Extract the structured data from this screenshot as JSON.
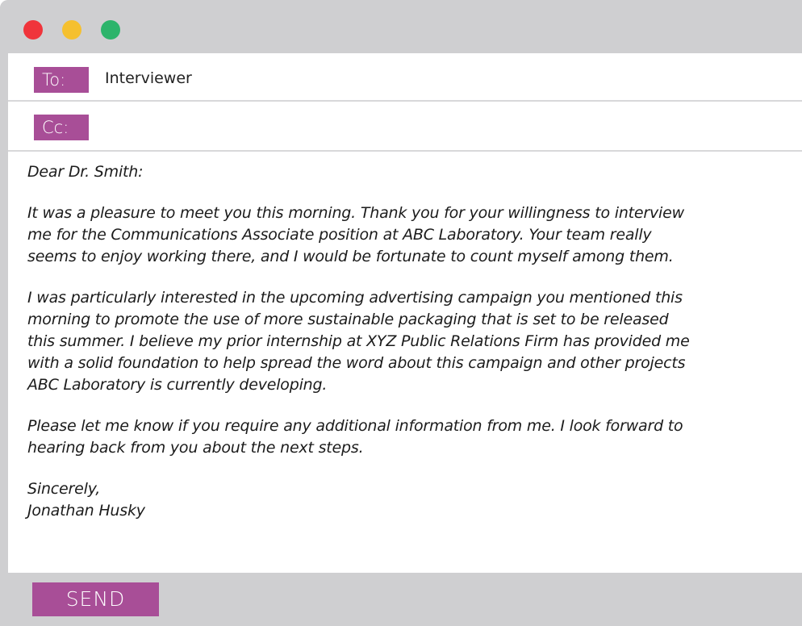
{
  "window": {
    "controls": [
      "close",
      "minimize",
      "maximize"
    ],
    "colors": {
      "close": "#f0343b",
      "minimize": "#f5c02f",
      "maximize": "#2db46b",
      "accent": "#a84e97"
    }
  },
  "header": {
    "to_label": "To:",
    "to_value": "Interviewer",
    "cc_label": "Cc:",
    "cc_value": ""
  },
  "body": {
    "greeting": "Dear Dr. Smith:",
    "paragraph1": [
      "It was a pleasure to meet you this morning. Thank you for your willingness to interview",
      "me for the Communications Associate position at ABC Laboratory. Your team really",
      "seems to enjoy working there, and I would be fortunate to count myself among them."
    ],
    "paragraph2": [
      "I was particularly interested in the upcoming advertising campaign you mentioned this",
      "morning to promote the use of more sustainable packaging that is set to be released",
      "this summer. I believe my prior internship at XYZ Public Relations Firm has provided me",
      "with a solid foundation to help spread the word about this campaign and other projects",
      "ABC Laboratory is currently developing."
    ],
    "paragraph3": [
      "Please let me know if you require any additional information from me. I look forward to",
      "hearing back from you about the next steps."
    ],
    "closing": "Sincerely,",
    "signature": "Jonathan Husky"
  },
  "footer": {
    "send_label": "SEND"
  }
}
